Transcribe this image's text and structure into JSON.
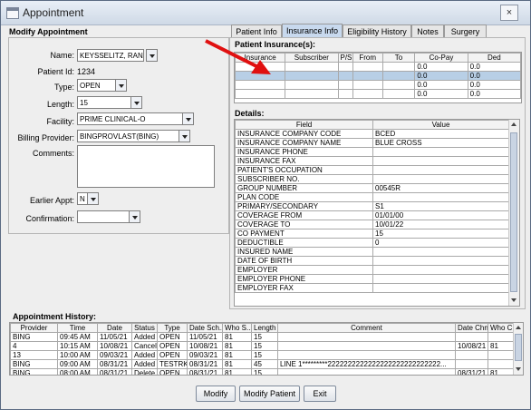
{
  "window": {
    "title": "Appointment",
    "close_label": "×"
  },
  "modify": {
    "group_title": "Modify Appointment",
    "name_label": "Name:",
    "name_value": "KEYSSELITZ, RANDA",
    "patient_id_label": "Patient Id:",
    "patient_id_value": "1234",
    "type_label": "Type:",
    "type_value": "OPEN",
    "length_label": "Length:",
    "length_value": "15",
    "facility_label": "Facility:",
    "facility_value": "PRIME CLINICAL-O",
    "billing_label": "Billing Provider:",
    "billing_value": "BINGPROVLAST(BING)",
    "comments_label": "Comments:",
    "comments_value": "",
    "earlier_label": "Earlier Appt:",
    "earlier_value": "N",
    "confirmation_label": "Confirmation:",
    "confirmation_value": ""
  },
  "tabs": [
    "Patient Info",
    "Insurance Info",
    "Eligibility History",
    "Notes",
    "Surgery"
  ],
  "active_tab": 1,
  "insurance": {
    "group_title": "Patient Insurance(s):",
    "columns": [
      "Insurance",
      "Subscriber",
      "P/S",
      "From",
      "To",
      "Co-Pay",
      "Ded"
    ],
    "rows": [
      [
        "",
        "",
        "",
        "",
        "",
        "0.0",
        "0.0"
      ],
      [
        "",
        "",
        "",
        "",
        "",
        "0.0",
        "0.0"
      ],
      [
        "",
        "",
        "",
        "",
        "",
        "0.0",
        "0.0"
      ],
      [
        "",
        "",
        "",
        "",
        "",
        "0.0",
        "0.0"
      ]
    ],
    "selected_row": 1
  },
  "details": {
    "group_title": "Details:",
    "columns": [
      "Field",
      "Value"
    ],
    "rows": [
      [
        "INSURANCE COMPANY CODE",
        "BCED"
      ],
      [
        "INSURANCE COMPANY NAME",
        "BLUE CROSS"
      ],
      [
        "INSURANCE PHONE",
        ""
      ],
      [
        "INSURANCE FAX",
        ""
      ],
      [
        "PATIENT'S OCCUPATION",
        ""
      ],
      [
        "SUBSCRIBER NO.",
        ""
      ],
      [
        "GROUP NUMBER",
        "00545R"
      ],
      [
        "PLAN CODE",
        ""
      ],
      [
        "PRIMARY/SECONDARY",
        "S1"
      ],
      [
        "COVERAGE FROM",
        "01/01/00"
      ],
      [
        "COVERAGE TO",
        "10/01/22"
      ],
      [
        "CO PAYMENT",
        "15"
      ],
      [
        "DEDUCTIBLE",
        "0"
      ],
      [
        "INSURED NAME",
        ""
      ],
      [
        "DATE OF BIRTH",
        ""
      ],
      [
        "EMPLOYER",
        ""
      ],
      [
        "EMPLOYER PHONE",
        ""
      ],
      [
        "EMPLOYER FAX",
        ""
      ]
    ]
  },
  "history": {
    "group_title": "Appointment History:",
    "columns": [
      "Provider",
      "Time",
      "Date",
      "Status",
      "Type",
      "Date Sch...",
      "Who S...",
      "Length",
      "Comment",
      "Date Chng",
      "Who Chng"
    ],
    "rows": [
      [
        "BING",
        "09:45 AM",
        "11/05/21",
        "Added",
        "OPEN",
        "11/05/21",
        "81",
        "15",
        "",
        "",
        ""
      ],
      [
        "4",
        "10:15 AM",
        "10/08/21",
        "Cancel",
        "OPEN",
        "10/08/21",
        "81",
        "15",
        "",
        "10/08/21",
        "81"
      ],
      [
        "13",
        "10:00 AM",
        "09/03/21",
        "Added",
        "OPEN",
        "09/03/21",
        "81",
        "15",
        "",
        "",
        ""
      ],
      [
        "BING",
        "09:00 AM",
        "08/31/21",
        "Added",
        "TESTRK",
        "08/31/21",
        "81",
        "45",
        "LINE 1*********2222222222222222222222222222...",
        "",
        ""
      ],
      [
        "BING",
        "08:00 AM",
        "08/31/21",
        "Delete",
        "OPEN",
        "08/31/21",
        "81",
        "15",
        "",
        "08/31/21",
        "81"
      ]
    ]
  },
  "buttons": {
    "modify": "Modify",
    "modify_patient": "Modify Patient",
    "exit": "Exit"
  },
  "colors": {
    "selected_row": "#b8cfe6",
    "arrow": "#e01010",
    "tab_active": "#c8d9ee"
  }
}
